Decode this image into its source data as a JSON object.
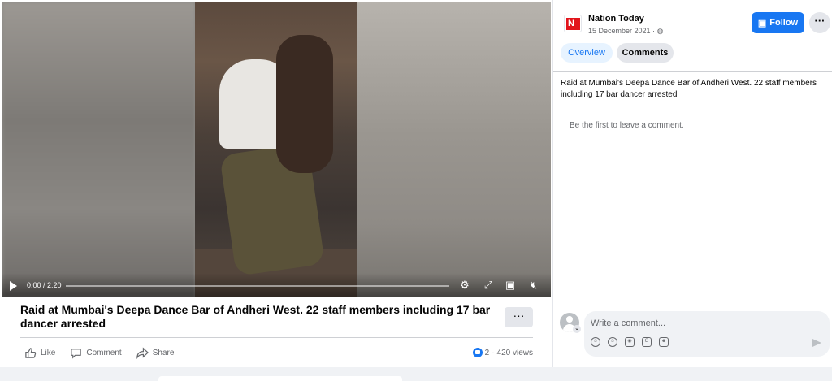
{
  "video": {
    "time": "0:00 / 2:20",
    "progress": 0
  },
  "post": {
    "title": "Raid at Mumbai's Deepa Dance Bar of Andheri West. 22 staff members including 17 bar dancer arrested",
    "more_label": "···",
    "actions": [
      {
        "label": "Like",
        "icon": "thumbs-up-icon"
      },
      {
        "label": "Comment",
        "icon": "comment-icon"
      },
      {
        "label": "Share",
        "icon": "share-icon"
      }
    ],
    "reactions_count": "2",
    "separator": "·",
    "views": "420 views"
  },
  "sidebar": {
    "page_name": "Nation Today",
    "logo_letter": "N",
    "date": "15 December 2021 ·",
    "follow_label": "Follow",
    "more_label": "···",
    "tabs": [
      {
        "label": "Overview",
        "active": true
      },
      {
        "label": "Comments",
        "active": false
      }
    ],
    "description": "Raid at Mumbai's Deepa Dance Bar of Andheri West. 22 staff members including 17 bar dancer arrested",
    "empty_comments": "Be the first to leave a comment.",
    "comment_placeholder": "Write a comment...",
    "composer_icons": [
      "avatar-sticker-icon",
      "emoji-icon",
      "camera-icon",
      "gif-icon",
      "sticker-icon"
    ]
  },
  "colors": {
    "accent": "#1877f2",
    "brand_logo": "#e2141b"
  }
}
